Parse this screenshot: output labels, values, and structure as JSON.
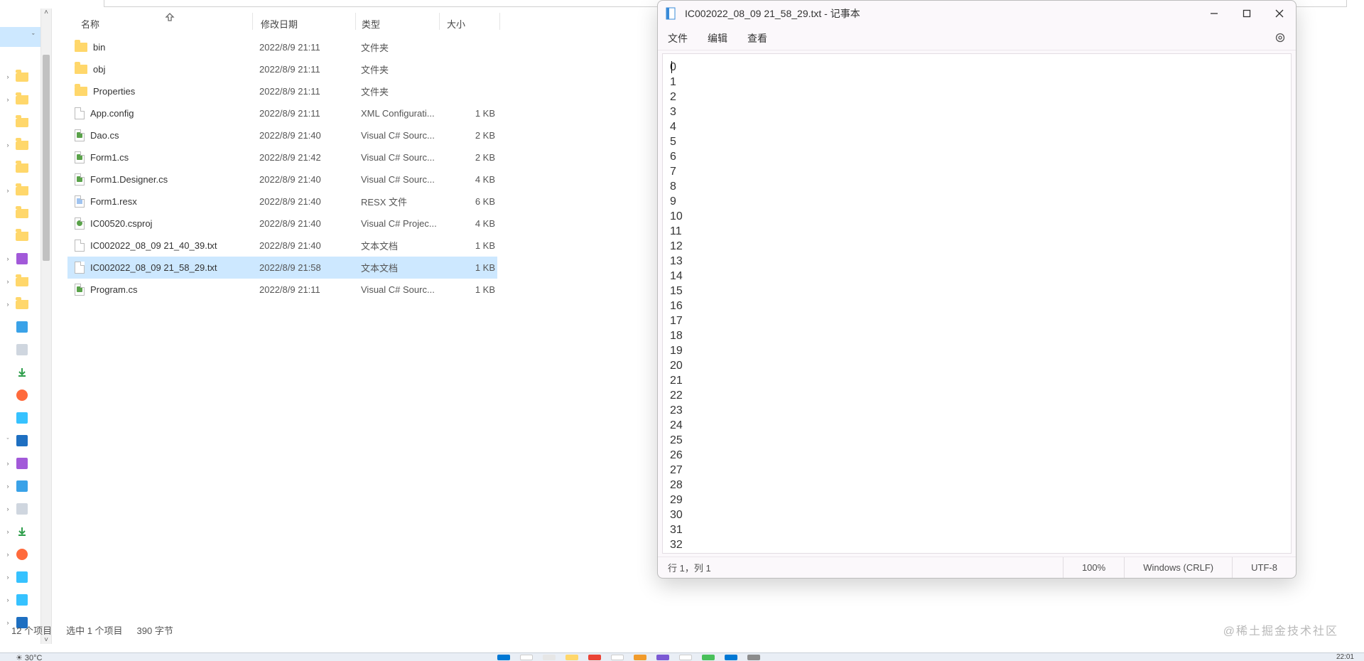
{
  "explorer": {
    "columns": {
      "name": "名称",
      "modified": "修改日期",
      "type": "类型",
      "size": "大小"
    },
    "tree_items": [
      {
        "expand": "",
        "icon": "none",
        "extra": ""
      },
      {
        "expand": "›",
        "icon": "folder"
      },
      {
        "expand": "›",
        "icon": "folder"
      },
      {
        "expand": "",
        "icon": "folder"
      },
      {
        "expand": "›",
        "icon": "folder"
      },
      {
        "expand": "",
        "icon": "folder"
      },
      {
        "expand": "›",
        "icon": "folder"
      },
      {
        "expand": "",
        "icon": "folder"
      },
      {
        "expand": "",
        "icon": "folder"
      },
      {
        "expand": "›",
        "icon": "vs"
      },
      {
        "expand": "›",
        "icon": "folder"
      },
      {
        "expand": "›",
        "icon": "folder"
      },
      {
        "expand": "",
        "icon": "pic"
      },
      {
        "expand": "",
        "icon": "doc"
      },
      {
        "expand": "",
        "icon": "dl"
      },
      {
        "expand": "",
        "icon": "mus"
      },
      {
        "expand": "",
        "icon": "vid"
      },
      {
        "expand": "ˇ",
        "icon": "pc",
        "sel": true
      },
      {
        "expand": "›",
        "icon": "vs"
      },
      {
        "expand": "›",
        "icon": "pic"
      },
      {
        "expand": "›",
        "icon": "doc"
      },
      {
        "expand": "›",
        "icon": "dl"
      },
      {
        "expand": "›",
        "icon": "mus"
      },
      {
        "expand": "›",
        "icon": "vid"
      },
      {
        "expand": "›",
        "icon": "vid"
      },
      {
        "expand": "›",
        "icon": "pc"
      }
    ],
    "files": [
      {
        "icon": "folder",
        "name": "bin",
        "mod": "2022/8/9 21:11",
        "type": "文件夹",
        "size": ""
      },
      {
        "icon": "folder",
        "name": "obj",
        "mod": "2022/8/9 21:11",
        "type": "文件夹",
        "size": ""
      },
      {
        "icon": "folder",
        "name": "Properties",
        "mod": "2022/8/9 21:11",
        "type": "文件夹",
        "size": ""
      },
      {
        "icon": "file",
        "name": "App.config",
        "mod": "2022/8/9 21:11",
        "type": "XML Configurati...",
        "size": "1 KB"
      },
      {
        "icon": "cs",
        "name": "Dao.cs",
        "mod": "2022/8/9 21:40",
        "type": "Visual C# Sourc...",
        "size": "2 KB"
      },
      {
        "icon": "cs",
        "name": "Form1.cs",
        "mod": "2022/8/9 21:42",
        "type": "Visual C# Sourc...",
        "size": "2 KB"
      },
      {
        "icon": "cs",
        "name": "Form1.Designer.cs",
        "mod": "2022/8/9 21:40",
        "type": "Visual C# Sourc...",
        "size": "4 KB"
      },
      {
        "icon": "resx",
        "name": "Form1.resx",
        "mod": "2022/8/9 21:40",
        "type": "RESX 文件",
        "size": "6 KB"
      },
      {
        "icon": "csprj",
        "name": "IC00520.csproj",
        "mod": "2022/8/9 21:40",
        "type": "Visual C# Projec...",
        "size": "4 KB"
      },
      {
        "icon": "file",
        "name": "IC002022_08_09 21_40_39.txt",
        "mod": "2022/8/9 21:40",
        "type": "文本文档",
        "size": "1 KB"
      },
      {
        "icon": "file",
        "name": "IC002022_08_09 21_58_29.txt",
        "mod": "2022/8/9 21:58",
        "type": "文本文档",
        "size": "1 KB",
        "sel": true
      },
      {
        "icon": "cs",
        "name": "Program.cs",
        "mod": "2022/8/9 21:11",
        "type": "Visual C# Sourc...",
        "size": "1 KB"
      }
    ],
    "status_items": "12 个项目",
    "status_sel": "选中 1 个项目",
    "status_bytes": "390 字节"
  },
  "notepad": {
    "title": "IC002022_08_09 21_58_29.txt - 记事本",
    "menu": {
      "file": "文件",
      "edit": "编辑",
      "view": "查看"
    },
    "content": [
      "0",
      "1",
      "2",
      "3",
      "4",
      "5",
      "6",
      "7",
      "8",
      "9",
      "10",
      "11",
      "12",
      "13",
      "14",
      "15",
      "16",
      "17",
      "18",
      "19",
      "20",
      "21",
      "22",
      "23",
      "24",
      "25",
      "26",
      "27",
      "28",
      "29",
      "30",
      "31",
      "32"
    ],
    "status": {
      "pos": "行 1，列 1",
      "zoom": "100%",
      "eol": "Windows (CRLF)",
      "enc": "UTF-8"
    }
  },
  "watermark": "@稀土掘金技术社区",
  "taskbar": {
    "temp": "30°C",
    "time": "22:01"
  }
}
